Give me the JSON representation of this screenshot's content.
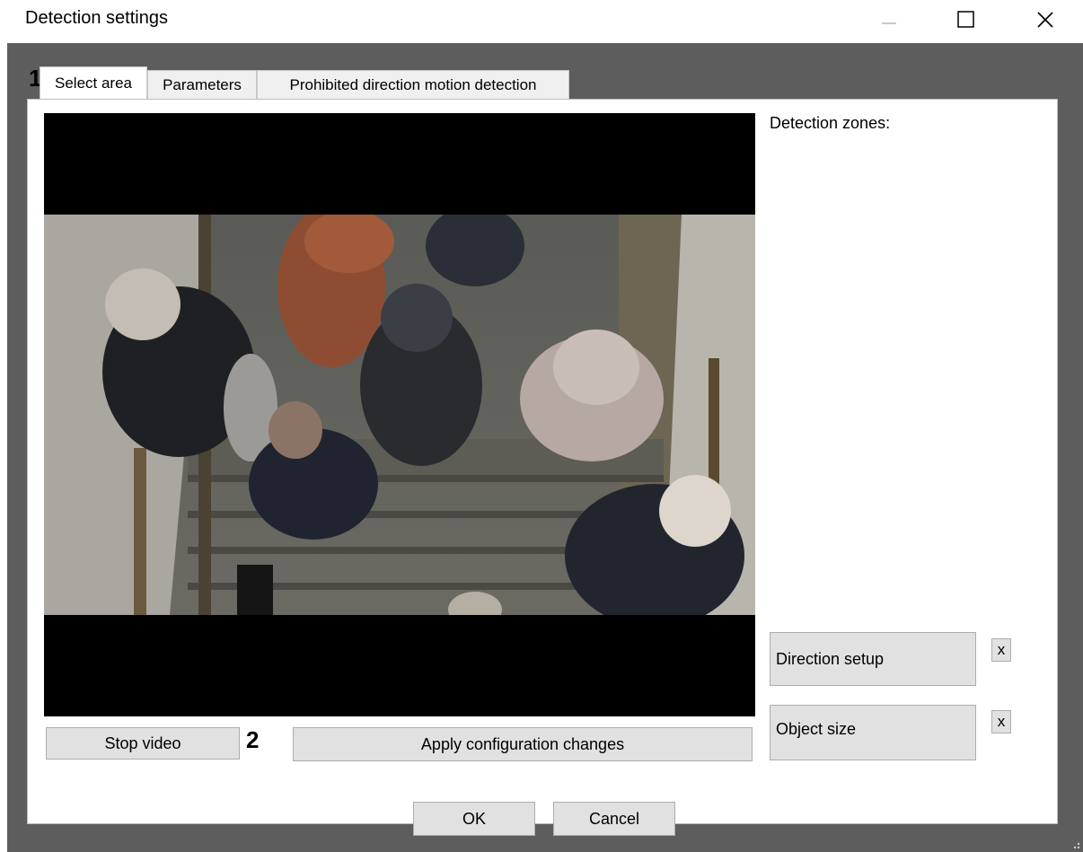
{
  "window": {
    "title": "Detection settings",
    "minimize_icon": "minimize-icon",
    "maximize_icon": "maximize-icon",
    "close_icon": "close-icon"
  },
  "tabs": [
    {
      "label": "Select area",
      "active": true
    },
    {
      "label": "Parameters",
      "active": false
    },
    {
      "label": "Prohibited direction motion detection",
      "active": false
    }
  ],
  "markers": {
    "one": "1",
    "two": "2"
  },
  "zones": {
    "heading": "Detection zones:"
  },
  "side_buttons": {
    "direction_setup": "Direction setup",
    "object_size": "Object size",
    "remove": "x"
  },
  "video_controls": {
    "stop_video": "Stop video",
    "apply": "Apply configuration changes"
  },
  "footer": {
    "ok": "OK",
    "cancel": "Cancel"
  },
  "colors": {
    "dialog_bg": "#5d5d5d",
    "panel_bg": "#ffffff",
    "button_bg": "#e1e1e1",
    "video_bg": "#000000"
  }
}
